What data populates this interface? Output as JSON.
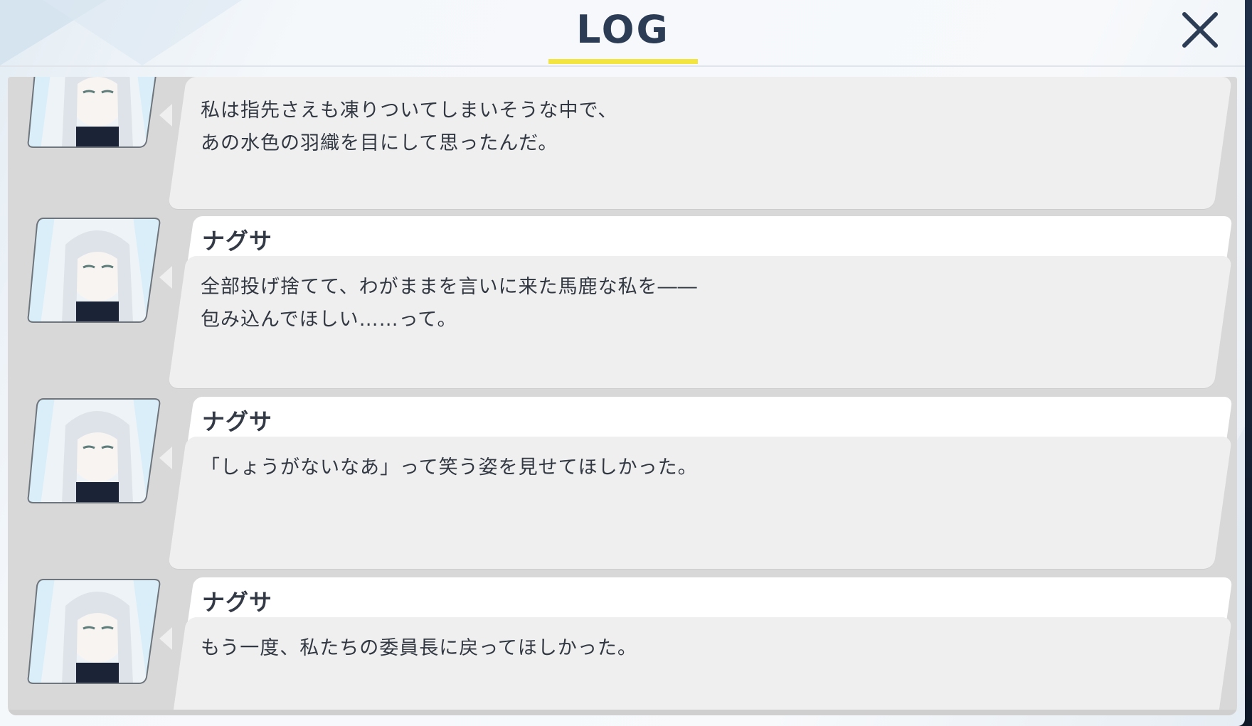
{
  "header": {
    "title": "LOG",
    "close_icon": "close-icon"
  },
  "colors": {
    "title": "#2c3c55",
    "accent_underline": "#f3e53d",
    "panel": "#d8d8d8",
    "bubble": "#efefef",
    "name_bar": "#ffffff"
  },
  "log": {
    "entries": [
      {
        "speaker": "",
        "avatar": "character-portrait",
        "message": "私は指先さえも凍りついてしまいそうな中で、\nあの水色の羽織を目にして思ったんだ。"
      },
      {
        "speaker": "ナグサ",
        "avatar": "character-portrait",
        "message": "全部投げ捨てて、わがままを言いに来た馬鹿な私を――\n包み込んでほしい……って。"
      },
      {
        "speaker": "ナグサ",
        "avatar": "character-portrait",
        "message": "「しょうがないなあ」って笑う姿を見せてほしかった。"
      },
      {
        "speaker": "ナグサ",
        "avatar": "character-portrait",
        "message": "もう一度、私たちの委員長に戻ってほしかった。"
      }
    ]
  }
}
